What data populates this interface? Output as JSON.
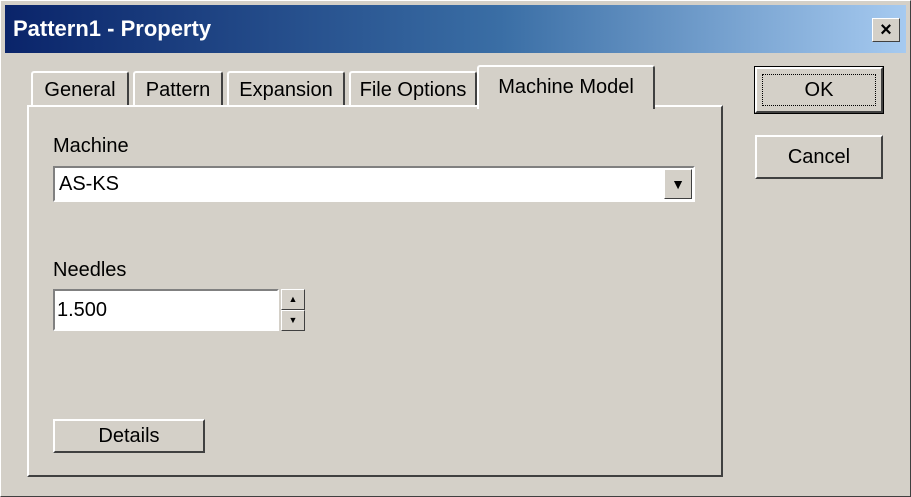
{
  "window": {
    "title": "Pattern1 - Property",
    "close_glyph": "×"
  },
  "tabs": [
    {
      "label": "General",
      "active": false
    },
    {
      "label": "Pattern",
      "active": false
    },
    {
      "label": "Expansion",
      "active": false
    },
    {
      "label": "File Options",
      "active": false
    },
    {
      "label": "Machine Model",
      "active": true
    }
  ],
  "machine": {
    "label": "Machine",
    "value": "AS-KS",
    "arrow_glyph": "▼"
  },
  "needles": {
    "label": "Needles",
    "value": "1.500",
    "up_glyph": "▲",
    "down_glyph": "▼"
  },
  "buttons": {
    "details": "Details",
    "ok": "OK",
    "cancel": "Cancel"
  },
  "colors": {
    "titlebar_start": "#0a246a",
    "titlebar_end": "#a6caf0",
    "face": "#d4d0c8"
  }
}
